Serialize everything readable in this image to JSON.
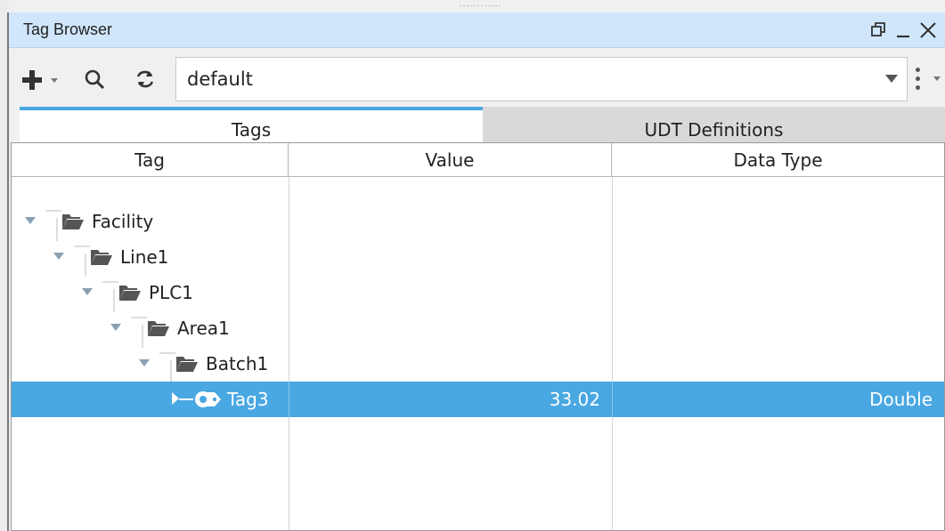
{
  "window": {
    "title": "Tag Browser",
    "controls": {
      "restore_icon": "restore-window-icon",
      "minimize_icon": "minimize-icon",
      "close_icon": "close-icon"
    }
  },
  "toolbar": {
    "add_icon": "plus-icon",
    "search_icon": "search-icon",
    "refresh_icon": "refresh-icon",
    "provider": "default",
    "menu_icon": "kebab-menu-icon"
  },
  "tabs": [
    {
      "label": "Tags",
      "active": true
    },
    {
      "label": "UDT Definitions",
      "active": false
    }
  ],
  "table": {
    "columns": [
      "Tag",
      "Value",
      "Data Type"
    ],
    "rows": [
      {
        "name": "Facility",
        "depth": 0,
        "type": "folder",
        "value": "",
        "data_type": ""
      },
      {
        "name": "Line1",
        "depth": 1,
        "type": "folder",
        "value": "",
        "data_type": ""
      },
      {
        "name": "PLC1",
        "depth": 2,
        "type": "folder",
        "value": "",
        "data_type": ""
      },
      {
        "name": "Area1",
        "depth": 3,
        "type": "folder",
        "value": "",
        "data_type": ""
      },
      {
        "name": "Batch1",
        "depth": 4,
        "type": "folder",
        "value": "",
        "data_type": ""
      },
      {
        "name": "Tag3",
        "depth": 5,
        "type": "tag",
        "value": "33.02",
        "data_type": "Double",
        "selected": true
      }
    ]
  },
  "colors": {
    "titlebar": "#cfe6fb",
    "accent": "#4aa6e0",
    "selection": "#49a7e2"
  }
}
